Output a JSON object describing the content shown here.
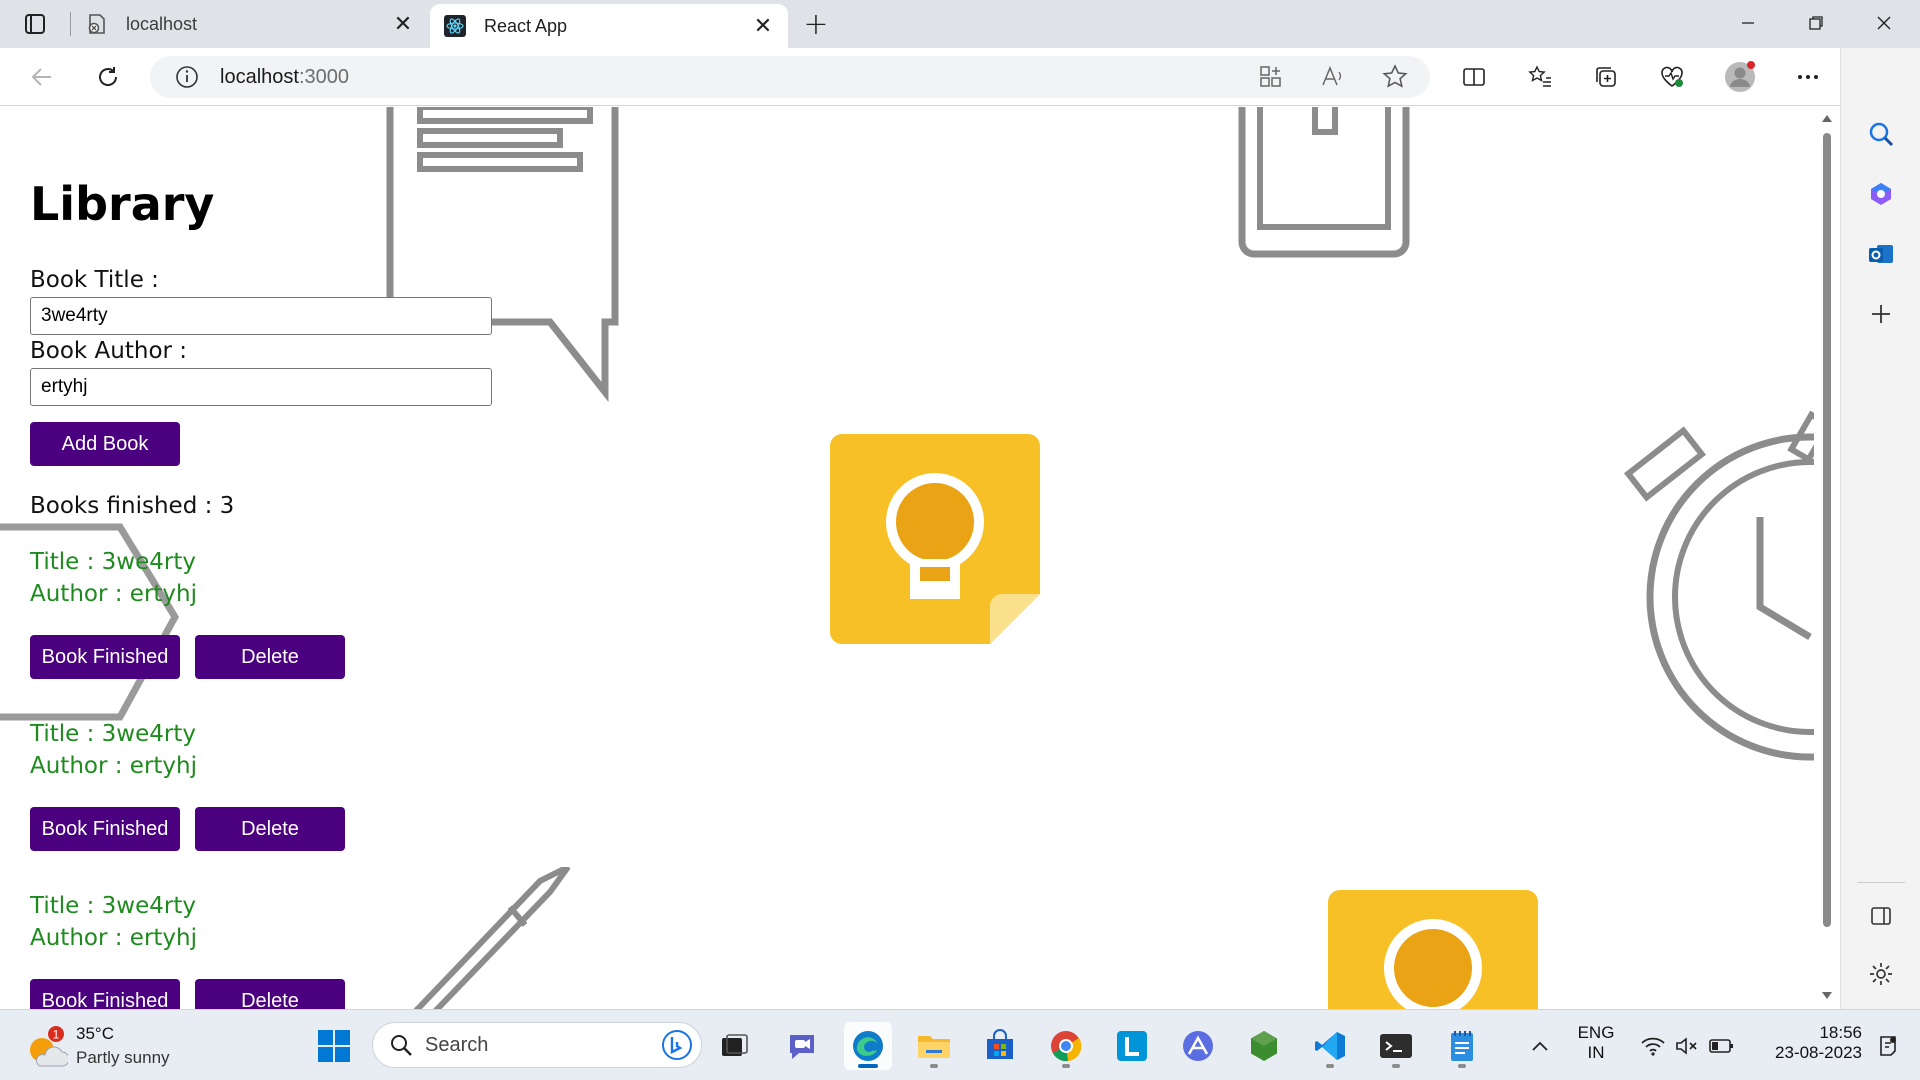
{
  "browser": {
    "tabs": [
      {
        "title": "localhost",
        "active": false
      },
      {
        "title": "React App",
        "active": true
      }
    ],
    "address": {
      "host": "localhost",
      "port": ":3000"
    },
    "close_glyph": "✕",
    "new_tab_glyph": "+"
  },
  "page": {
    "title": "Library",
    "form": {
      "title_label": "Book Title :",
      "title_value": "3we4rty",
      "author_label": "Book Author :",
      "author_value": "ertyhj",
      "add_button": "Add Book"
    },
    "finished_text": "Books finished : 3",
    "books": [
      {
        "title": "Title : 3we4rty",
        "author": "Author : ertyhj",
        "finished_label": "Book Finished",
        "delete_label": "Delete"
      },
      {
        "title": "Title : 3we4rty",
        "author": "Author : ertyhj",
        "finished_label": "Book Finished",
        "delete_label": "Delete"
      },
      {
        "title": "Title : 3we4rty",
        "author": "Author : ertyhj",
        "finished_label": "Book Finished",
        "delete_label": "Delete"
      }
    ]
  },
  "taskbar": {
    "weather": {
      "temp": "35°C",
      "desc": "Partly sunny",
      "badge": "1"
    },
    "search_placeholder": "Search",
    "language": {
      "line1": "ENG",
      "line2": "IN"
    },
    "clock": {
      "time": "18:56",
      "date": "23-08-2023"
    }
  },
  "colors": {
    "button_bg": "#4b0080",
    "book_text": "#1f8a1f",
    "keep_yellow": "#f6c026"
  }
}
